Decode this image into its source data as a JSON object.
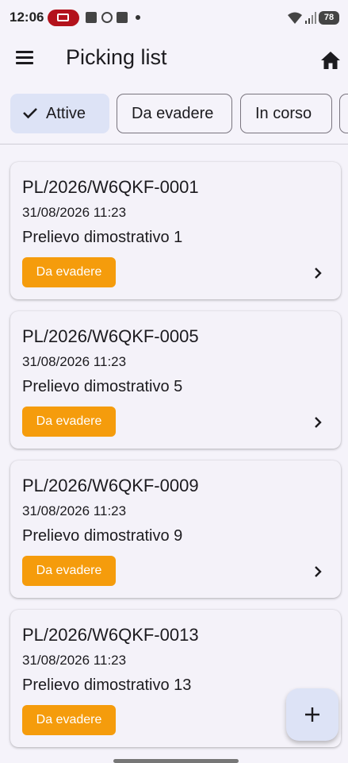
{
  "status_bar": {
    "time": "12:06",
    "battery": "78",
    "accent_color": "#b3121c",
    "icons": [
      "cast-icon",
      "notification-icon",
      "whatsapp-icon",
      "calendar-icon",
      "wifi-icon",
      "signal-icon",
      "battery-icon"
    ]
  },
  "app_bar": {
    "title": "Picking list",
    "menu_icon": "menu-icon",
    "home_icon": "home-icon"
  },
  "filters": {
    "chips": [
      {
        "label": "Attive",
        "selected": true
      },
      {
        "label": "Da evadere",
        "selected": false
      },
      {
        "label": "In corso",
        "selected": false
      }
    ]
  },
  "list": {
    "items": [
      {
        "code": "PL/2026/W6QKF-0001",
        "date": "31/08/2026 11:23",
        "description": "Prelievo dimostrativo 1",
        "status": "Da evadere"
      },
      {
        "code": "PL/2026/W6QKF-0005",
        "date": "31/08/2026 11:23",
        "description": "Prelievo dimostrativo 5",
        "status": "Da evadere"
      },
      {
        "code": "PL/2026/W6QKF-0009",
        "date": "31/08/2026 11:23",
        "description": "Prelievo dimostrativo 9",
        "status": "Da evadere"
      },
      {
        "code": "PL/2026/W6QKF-0013",
        "date": "31/08/2026 11:23",
        "description": "Prelievo dimostrativo 13",
        "status": "Da evadere"
      }
    ]
  },
  "colors": {
    "background": "#f5f3fa",
    "status_badge": "#f59c0c",
    "chip_selected": "#dde3f6",
    "fab": "#dde3f6"
  },
  "fab": {
    "icon": "plus-icon"
  }
}
